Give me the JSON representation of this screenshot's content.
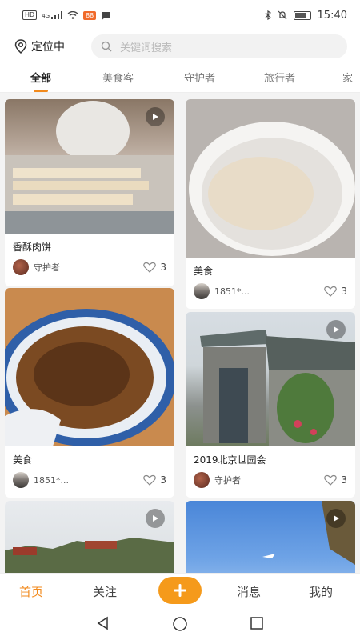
{
  "status": {
    "time": "15:40",
    "hd": "HD",
    "signal": "4G",
    "app_badge": "88"
  },
  "header": {
    "location_label": "定位中",
    "search_placeholder": "关键词搜索"
  },
  "tabs": [
    {
      "label": "全部",
      "active": true
    },
    {
      "label": "美食客",
      "active": false
    },
    {
      "label": "守护者",
      "active": false
    },
    {
      "label": "旅行者",
      "active": false
    },
    {
      "label": "家",
      "active": false
    }
  ],
  "feed": [
    {
      "title": "香酥肉饼",
      "author": "守护者",
      "likes": "3",
      "video": true
    },
    {
      "title": "美食",
      "author": "1851*...",
      "likes": "3",
      "video": false
    },
    {
      "title": "美食",
      "author": "1851*...",
      "likes": "3",
      "video": false
    },
    {
      "title": "2019北京世园会",
      "author": "守护者",
      "likes": "3",
      "video": true
    },
    {
      "title": "",
      "author": "",
      "likes": "",
      "video": true
    },
    {
      "title": "",
      "author": "",
      "likes": "",
      "video": true
    }
  ],
  "nav": {
    "home": "首页",
    "follow": "关注",
    "messages": "消息",
    "me": "我的"
  },
  "colors": {
    "accent": "#f28a1c",
    "add_button": "#f59a1b"
  }
}
